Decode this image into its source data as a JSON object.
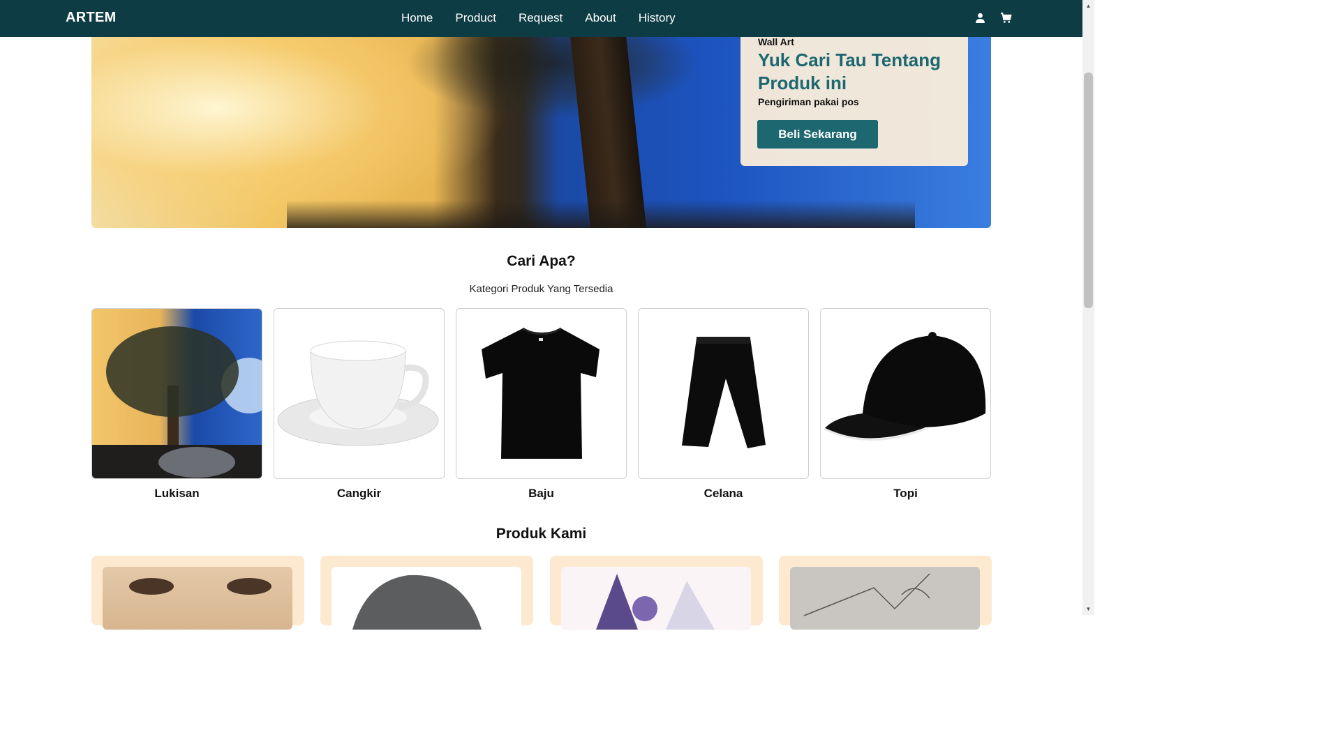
{
  "nav": {
    "brand": "ARTEM",
    "links": [
      "Home",
      "Product",
      "Request",
      "About",
      "History"
    ],
    "icons": [
      "user-icon",
      "cart-icon"
    ]
  },
  "hero": {
    "label": "Wall Art",
    "title": "Yuk Cari Tau Tentang Produk ini",
    "subtitle": "Pengiriman pakai pos",
    "button": "Beli Sekarang"
  },
  "categories": {
    "title": "Cari Apa?",
    "subtitle": "Kategori Produk Yang Tersedia",
    "items": [
      "Lukisan",
      "Cangkir",
      "Baju",
      "Celana",
      "Topi"
    ]
  },
  "products": {
    "title": "Produk Kami"
  },
  "colors": {
    "navbar": "#0d3c44",
    "accent": "#1c6770",
    "card_bg": "#fde9cf"
  }
}
